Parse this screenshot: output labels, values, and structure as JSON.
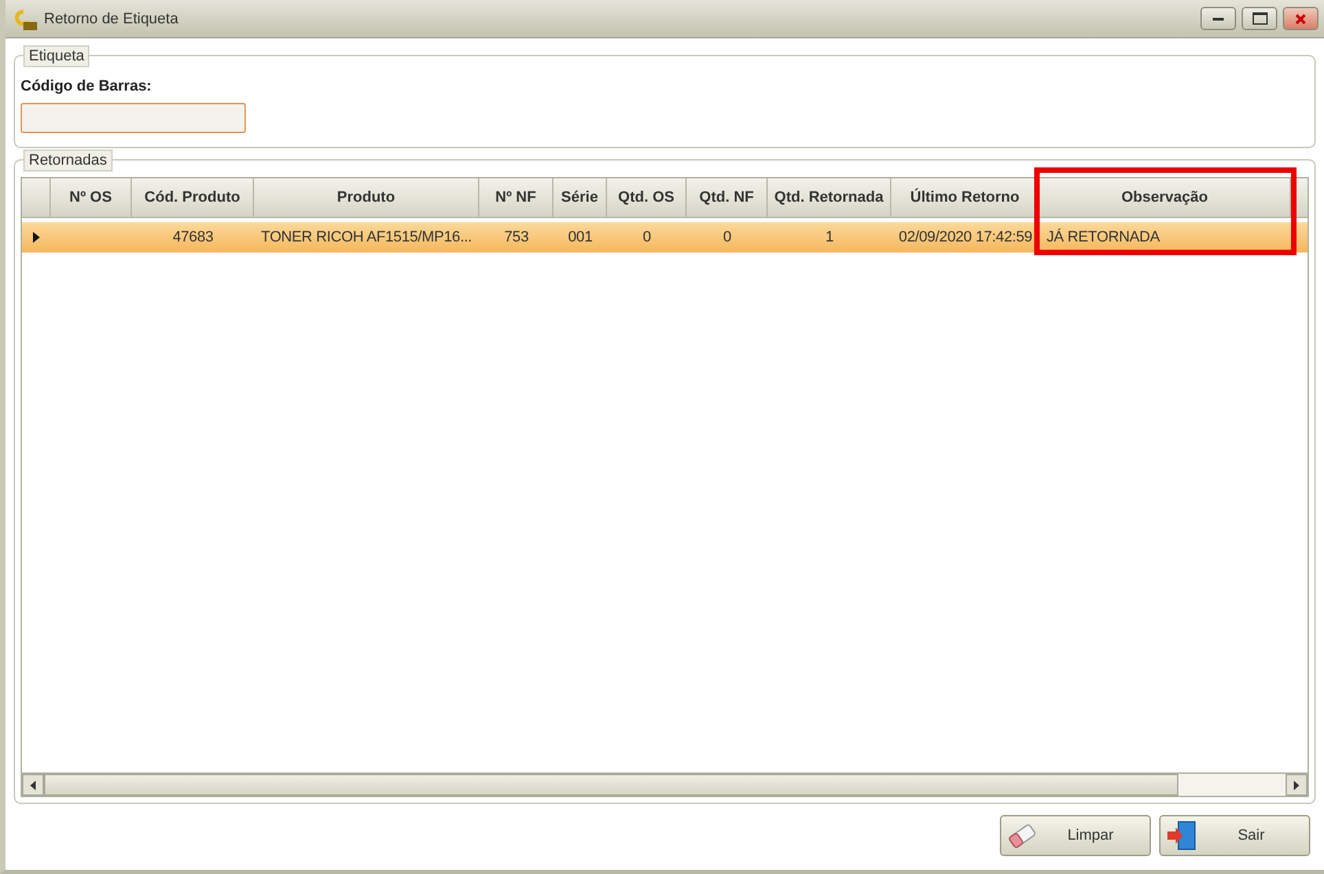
{
  "window": {
    "title": "Retorno de Etiqueta"
  },
  "etiqueta": {
    "legend": "Etiqueta",
    "label": "Código de Barras:"
  },
  "retornadas": {
    "legend": "Retornadas",
    "columns": [
      {
        "label": "Nº OS",
        "highlighted": false
      },
      {
        "label": "Cód. Produto",
        "highlighted": false
      },
      {
        "label": "Produto",
        "highlighted": false
      },
      {
        "label": "Nº NF",
        "highlighted": false
      },
      {
        "label": "Série",
        "highlighted": false
      },
      {
        "label": "Qtd. OS",
        "highlighted": false
      },
      {
        "label": "Qtd. NF",
        "highlighted": false
      },
      {
        "label": "Qtd. Retornada",
        "highlighted": false
      },
      {
        "label": "Último Retorno",
        "highlighted": false
      },
      {
        "label": "Observação",
        "highlighted": true
      }
    ],
    "rows": [
      {
        "selected": true,
        "cells": [
          null,
          "47683",
          "TONER  RICOH  AF1515/MP16...",
          "753",
          "001",
          "0",
          "0",
          "1",
          "02/09/2020 17:42:59",
          "JÁ RETORNADA"
        ]
      }
    ]
  },
  "buttons": [
    {
      "kind": "clear",
      "label": "Limpar"
    },
    {
      "kind": "exit",
      "label": "Sair"
    }
  ]
}
